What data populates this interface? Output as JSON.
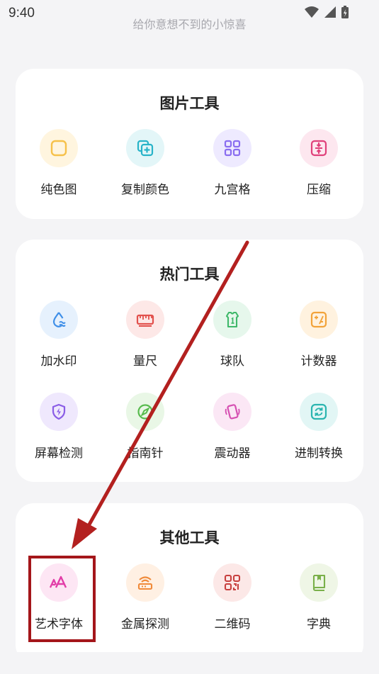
{
  "status_bar": {
    "time": "9:40"
  },
  "header": {
    "subtitle": "给你意想不到的小惊喜"
  },
  "sections": [
    {
      "title": "图片工具",
      "tools": [
        {
          "label": "纯色图",
          "icon": "square-outline-icon",
          "color": "#f6c14a",
          "bg": "#fff5df"
        },
        {
          "label": "复制颜色",
          "icon": "copy-plus-icon",
          "color": "#27b3c8",
          "bg": "#e3f6f8"
        },
        {
          "label": "九宫格",
          "icon": "grid-four-icon",
          "color": "#8a6df0",
          "bg": "#eeeaff"
        },
        {
          "label": "压缩",
          "icon": "compress-icon",
          "color": "#e0407a",
          "bg": "#fde7ef"
        }
      ]
    },
    {
      "title": "热门工具",
      "tools": [
        {
          "label": "加水印",
          "icon": "watermark-drop-icon",
          "color": "#3f8fe8",
          "bg": "#e6f1fd"
        },
        {
          "label": "量尺",
          "icon": "ruler-icon",
          "color": "#e2504c",
          "bg": "#fde8e7"
        },
        {
          "label": "球队",
          "icon": "jersey-icon",
          "color": "#3fb86a",
          "bg": "#e6f7ec"
        },
        {
          "label": "计数器",
          "icon": "counter-icon",
          "color": "#f2a33a",
          "bg": "#fff2df"
        },
        {
          "label": "屏幕检测",
          "icon": "shield-bolt-icon",
          "color": "#8a5de6",
          "bg": "#efe8fd"
        },
        {
          "label": "指南针",
          "icon": "compass-icon",
          "color": "#58bb4e",
          "bg": "#e9f7e6"
        },
        {
          "label": "震动器",
          "icon": "vibrate-phone-icon",
          "color": "#d650b2",
          "bg": "#fbe7f5"
        },
        {
          "label": "进制转换",
          "icon": "convert-icon",
          "color": "#2bb5b0",
          "bg": "#e2f6f5"
        }
      ]
    },
    {
      "title": "其他工具",
      "tools": [
        {
          "label": "艺术字体",
          "icon": "art-font-icon",
          "color": "#e23da8",
          "bg": "#fde6f4"
        },
        {
          "label": "金属探测",
          "icon": "metal-detector-icon",
          "color": "#f08a3a",
          "bg": "#fff0e3"
        },
        {
          "label": "二维码",
          "icon": "qr-code-icon",
          "color": "#c8403f",
          "bg": "#fce8e7"
        },
        {
          "label": "字典",
          "icon": "dictionary-book-icon",
          "color": "#7ab04a",
          "bg": "#eff6e6"
        }
      ]
    }
  ]
}
